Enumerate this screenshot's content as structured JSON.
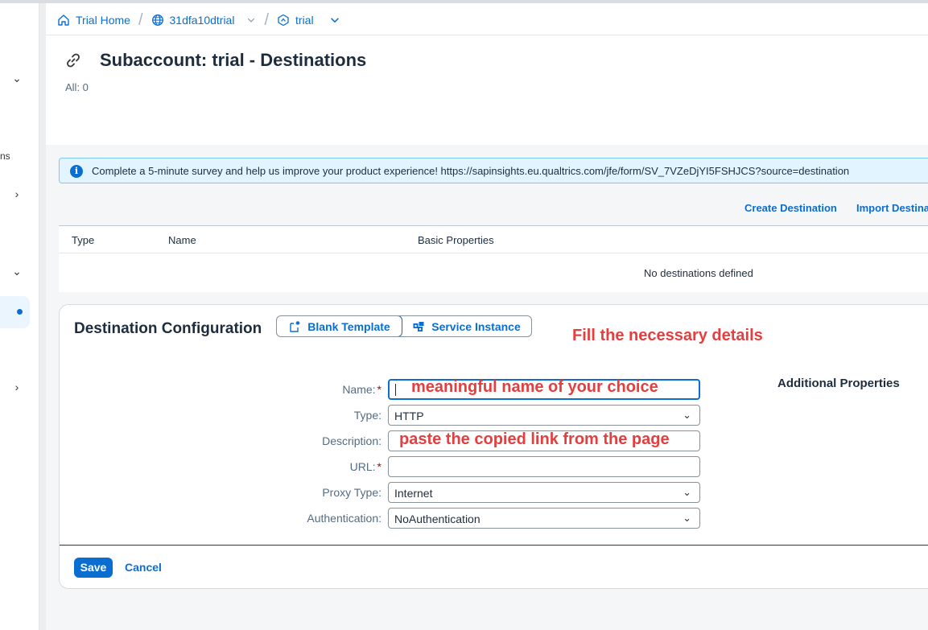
{
  "breadcrumb": {
    "items": [
      {
        "label": "Trial Home",
        "icon": "home-icon"
      },
      {
        "label": "31dfa10dtrial",
        "icon": "globe-icon"
      },
      {
        "label": "trial",
        "icon": "subaccount-icon"
      }
    ]
  },
  "sidenav": {
    "fragment_text": "ns"
  },
  "page": {
    "title": "Subaccount: trial - Destinations",
    "count_label": "All: 0"
  },
  "info_strip": {
    "message": "Complete a 5-minute survey and help us improve your product experience! https://sapinsights.eu.qualtrics.com/jfe/form/SV_7VZeDjYI5FSHJCS?source=destination"
  },
  "actions": {
    "create": "Create Destination",
    "import": "Import Destina"
  },
  "table": {
    "columns": [
      "Type",
      "Name",
      "Basic Properties"
    ],
    "empty_text": "No destinations defined"
  },
  "config": {
    "title": "Destination Configuration",
    "template_tabs": [
      "Blank Template",
      "Service Instance"
    ],
    "annotation": "Fill the necessary details",
    "additional_properties": "Additional Properties",
    "fields": {
      "name": {
        "label": "Name:",
        "value": "",
        "hint": "meaningful name of your choice"
      },
      "type": {
        "label": "Type:",
        "value": "HTTP"
      },
      "description": {
        "label": "Description:",
        "value": "",
        "hint": "paste the copied link from the page"
      },
      "url": {
        "label": "URL:",
        "value": ""
      },
      "proxy_type": {
        "label": "Proxy Type:",
        "value": "Internet"
      },
      "authentication": {
        "label": "Authentication:",
        "value": "NoAuthentication"
      }
    },
    "required_marker": "*",
    "save": "Save",
    "cancel": "Cancel"
  },
  "colors": {
    "accent": "#0a6ed1",
    "annotation": "#e53e3e",
    "info_bg": "#e1f4ff"
  }
}
